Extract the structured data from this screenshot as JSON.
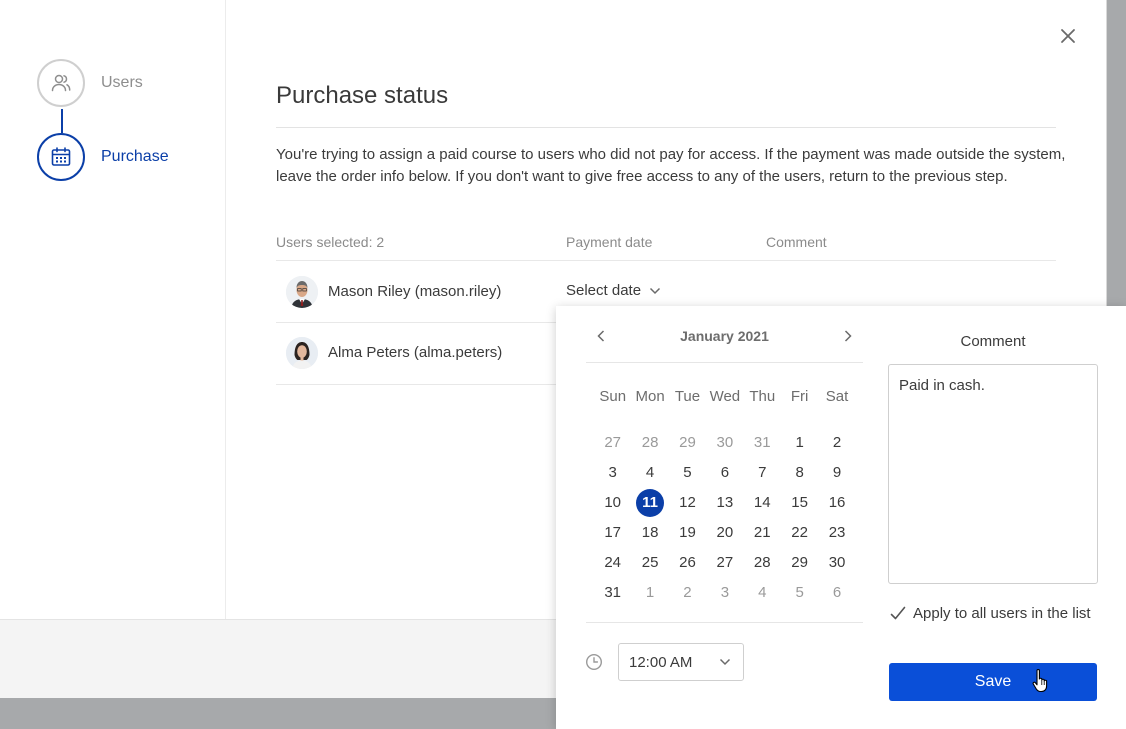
{
  "stepper": {
    "steps": [
      {
        "label": "Users",
        "icon": "users-icon",
        "state": "completed"
      },
      {
        "label": "Purchase",
        "icon": "calendar-icon",
        "state": "active"
      }
    ]
  },
  "page": {
    "title": "Purchase status",
    "description": "You're trying to assign a paid course to users who did not pay for access. If the payment was made outside the system, leave the order info below. If you don't want to give free access to any of the users, return to the previous step."
  },
  "table": {
    "headers": {
      "users": "Users selected: 2",
      "payment_date": "Payment date",
      "comment": "Comment"
    },
    "rows": [
      {
        "name": "Mason Riley (mason.riley)",
        "payment_date": "Select date"
      },
      {
        "name": "Alma Peters (alma.peters)"
      }
    ]
  },
  "datepicker": {
    "month_label": "January 2021",
    "weekdays": [
      "Sun",
      "Mon",
      "Tue",
      "Wed",
      "Thu",
      "Fri",
      "Sat"
    ],
    "weeks": [
      [
        "27",
        "28",
        "29",
        "30",
        "31",
        "1",
        "2"
      ],
      [
        "3",
        "4",
        "5",
        "6",
        "7",
        "8",
        "9"
      ],
      [
        "10",
        "11",
        "12",
        "13",
        "14",
        "15",
        "16"
      ],
      [
        "17",
        "18",
        "19",
        "20",
        "21",
        "22",
        "23"
      ],
      [
        "24",
        "25",
        "26",
        "27",
        "28",
        "29",
        "30"
      ],
      [
        "31",
        "1",
        "2",
        "3",
        "4",
        "5",
        "6"
      ]
    ],
    "selected_day": "11",
    "time_value": "12:00 AM",
    "comment_label": "Comment",
    "comment_value": "Paid in cash.",
    "apply_all_label": "Apply to all users in the list",
    "apply_all_checked": true,
    "save_label": "Save"
  },
  "colors": {
    "primary": "#0a4fd8",
    "active_step": "#0b3fa8",
    "selected_day": "#0b3fa8"
  }
}
